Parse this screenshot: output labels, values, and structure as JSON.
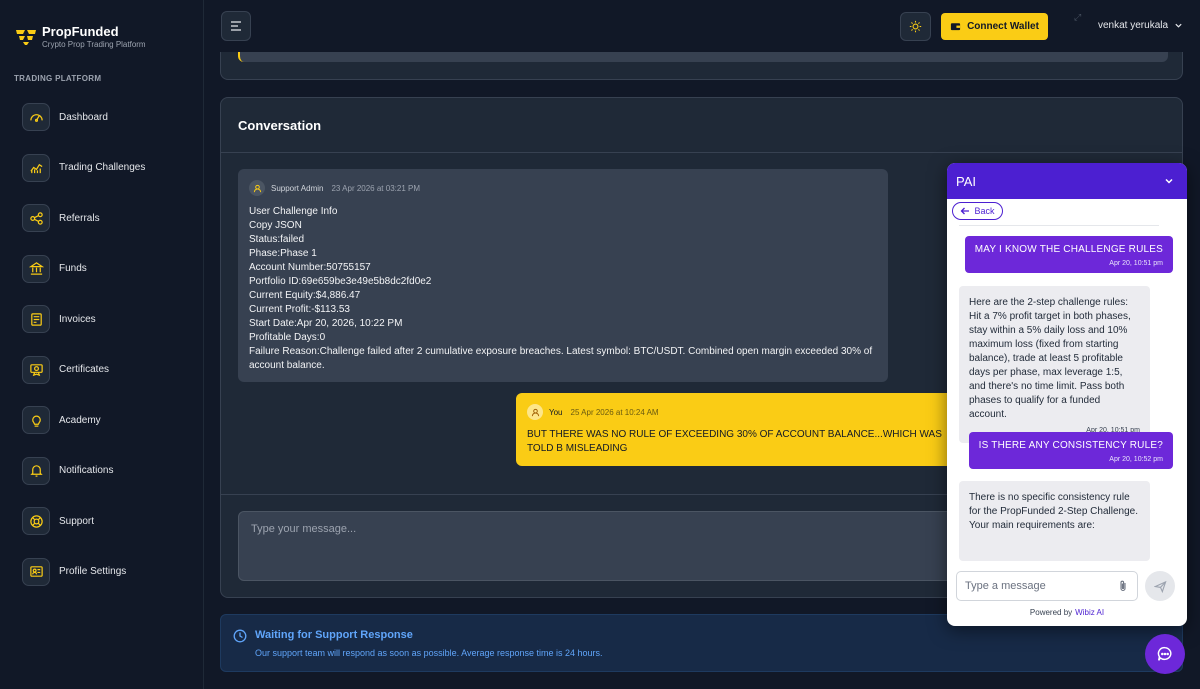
{
  "brand": {
    "name": "PropFunded",
    "tagline": "Crypto Prop Trading Platform"
  },
  "sidebar": {
    "section_label": "TRADING PLATFORM",
    "items": [
      {
        "label": "Dashboard",
        "icon": "gauge-icon"
      },
      {
        "label": "Trading Challenges",
        "icon": "chart-icon"
      },
      {
        "label": "Referrals",
        "icon": "share-icon"
      },
      {
        "label": "Funds",
        "icon": "bank-icon"
      },
      {
        "label": "Invoices",
        "icon": "invoice-icon"
      },
      {
        "label": "Certificates",
        "icon": "certificate-icon"
      },
      {
        "label": "Academy",
        "icon": "lightbulb-icon"
      },
      {
        "label": "Notifications",
        "icon": "bell-icon"
      },
      {
        "label": "Support",
        "icon": "support-icon"
      },
      {
        "label": "Profile Settings",
        "icon": "profile-card-icon"
      }
    ]
  },
  "header": {
    "wallet_button": "Connect Wallet",
    "user_name": "venkat yerukala",
    "expand_glyph": "⤢"
  },
  "conversation": {
    "title": "Conversation",
    "messages": [
      {
        "author": "Support Admin",
        "time": "23 Apr 2026 at 03:21 PM",
        "lines": [
          "User Challenge Info",
          "Copy JSON",
          "Status:failed",
          "Phase:Phase 1",
          "Account Number:50755157",
          "Portfolio ID:69e659be3e49e5b8dc2fd0e2",
          "Current Equity:$4,886.47",
          "Current Profit:-$113.53",
          "Start Date:Apr 20, 2026, 10:22 PM",
          "Profitable Days:0",
          "Failure Reason:Challenge failed after 2 cumulative exposure breaches. Latest symbol: BTC/USDT. Combined open margin exceeded 30% of account balance."
        ]
      },
      {
        "author": "You",
        "time": "25 Apr 2026 at 10:24 AM",
        "text": "BUT THERE WAS NO RULE OF EXCEEDING 30% OF ACCOUNT BALANCE...WHICH WAS TOLD B MISLEADING"
      }
    ],
    "compose_placeholder": "Type your message..."
  },
  "waiting": {
    "title": "Waiting for Support Response",
    "text": "Our support team will respond as soon as possible. Average response time is 24 hours."
  },
  "chat_widget": {
    "title": "PAI",
    "back_label": "Back",
    "messages": [
      {
        "role": "user",
        "text": "MAY I KNOW THE CHALLENGE RULES",
        "time": "Apr 20, 10:51 pm"
      },
      {
        "role": "bot",
        "text": "Here are the 2-step challenge rules: Hit a 7% profit target in both phases, stay within a 5% daily loss and 10% maximum loss (fixed from starting balance), trade at least 5 profitable days per phase, max leverage 1:5, and there's no time limit. Pass both phases to qualify for a funded account.",
        "time": "Apr 20, 10:51 pm"
      },
      {
        "role": "user",
        "text": "IS THERE ANY CONSISTENCY RULE?",
        "time": "Apr 20, 10:52 pm"
      },
      {
        "role": "bot",
        "text": "There is no specific consistency rule for the PropFunded 2-Step Challenge. Your main requirements are:",
        "time": ""
      }
    ],
    "input_placeholder": "Type a message",
    "powered_by": "Powered by",
    "powered_brand": "Wibiz AI"
  },
  "colors": {
    "accent_yellow": "#facc15",
    "widget_purple": "#4c1fd1",
    "info_blue": "#60a5fa",
    "background": "#111827",
    "card": "#1f2937"
  }
}
